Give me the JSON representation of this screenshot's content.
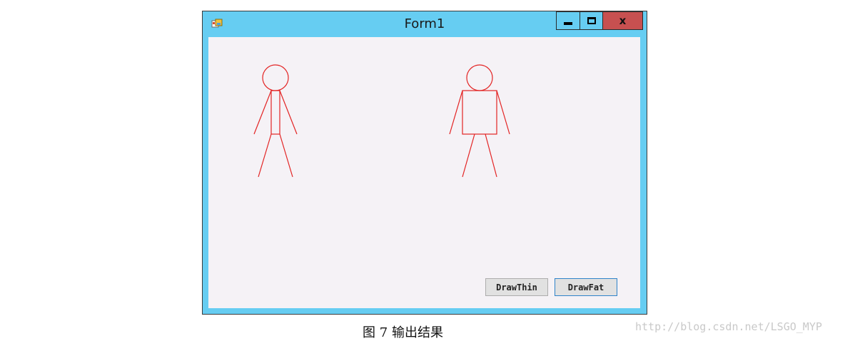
{
  "window": {
    "title": "Form1",
    "icon": "app-window-icon",
    "controls": {
      "minimize_icon": "minimize-icon",
      "maximize_icon": "maximize-icon",
      "close_label": "x"
    },
    "accent_color": "#66cdf2",
    "close_color": "#c75050",
    "client_color": "#f5f2f6"
  },
  "figures": {
    "stroke_color": "#e32323",
    "items": [
      "thin-stick-figure",
      "fat-stick-figure"
    ]
  },
  "buttons": {
    "draw_thin": "DrawThin",
    "draw_fat": "DrawFat"
  },
  "caption": "图 7  输出结果",
  "watermark": "http://blog.csdn.net/LSGO_MYP"
}
